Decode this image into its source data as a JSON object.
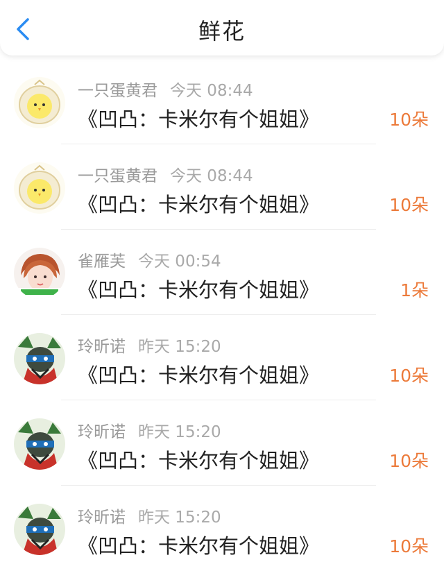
{
  "header": {
    "title": "鲜花",
    "back_icon": "chevron-left-icon",
    "accent": "#2b8cf2"
  },
  "colors": {
    "count": "#ec7a3a",
    "name": "#9a9a9a",
    "text": "#222222"
  },
  "items": [
    {
      "avatar": "chick-avatar",
      "name": "一只蛋黄君",
      "time": "今天 08:44",
      "book": "《凹凸：卡米尔有个姐姐》",
      "count": "10朵"
    },
    {
      "avatar": "chick-avatar",
      "name": "一只蛋黄君",
      "time": "今天 08:44",
      "book": "《凹凸：卡米尔有个姐姐》",
      "count": "10朵"
    },
    {
      "avatar": "girl-avatar",
      "name": "雀雁芙",
      "time": "今天 00:54",
      "book": "《凹凸：卡米尔有个姐姐》",
      "count": "1朵"
    },
    {
      "avatar": "anime-avatar",
      "name": "玲昕诺",
      "time": "昨天 15:20",
      "book": "《凹凸：卡米尔有个姐姐》",
      "count": "10朵"
    },
    {
      "avatar": "anime-avatar",
      "name": "玲昕诺",
      "time": "昨天 15:20",
      "book": "《凹凸：卡米尔有个姐姐》",
      "count": "10朵"
    },
    {
      "avatar": "anime-avatar",
      "name": "玲昕诺",
      "time": "昨天 15:20",
      "book": "《凹凸：卡米尔有个姐姐》",
      "count": "10朵"
    }
  ]
}
